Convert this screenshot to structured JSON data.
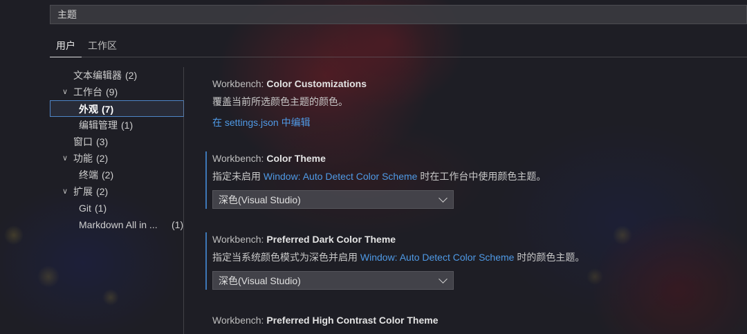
{
  "search": {
    "value": "主题"
  },
  "tabs": [
    {
      "label": "用户",
      "active": true
    },
    {
      "label": "工作区",
      "active": false
    }
  ],
  "toc": [
    {
      "label": "文本编辑器",
      "count": "(2)",
      "indent": 1,
      "chevron": false
    },
    {
      "label": "工作台",
      "count": "(9)",
      "indent": 1,
      "chevron": true
    },
    {
      "label": "外观",
      "count": "(7)",
      "indent": 2,
      "chevron": false,
      "selected": true
    },
    {
      "label": "编辑管理",
      "count": "(1)",
      "indent": 2,
      "chevron": false
    },
    {
      "label": "窗口",
      "count": "(3)",
      "indent": 1,
      "chevron": false
    },
    {
      "label": "功能",
      "count": "(2)",
      "indent": 1,
      "chevron": true
    },
    {
      "label": "终端",
      "count": "(2)",
      "indent": 2,
      "chevron": false
    },
    {
      "label": "扩展",
      "count": "(2)",
      "indent": 1,
      "chevron": true
    },
    {
      "label": "Git",
      "count": "(1)",
      "indent": 2,
      "chevron": false
    },
    {
      "label": "Markdown All in ...",
      "count": "(1)",
      "indent": 2,
      "chevron": false
    }
  ],
  "settings": {
    "color_customizations": {
      "category": "Workbench: ",
      "name": "Color Customizations",
      "description": "覆盖当前所选颜色主题的颜色。",
      "edit_link": "在 settings.json 中编辑"
    },
    "color_theme": {
      "category": "Workbench: ",
      "name": "Color Theme",
      "desc_before": "指定未启用 ",
      "desc_link": "Window: Auto Detect Color Scheme",
      "desc_after": " 时在工作台中使用颜色主题。",
      "value": "深色(Visual Studio)"
    },
    "preferred_dark": {
      "category": "Workbench: ",
      "name": "Preferred Dark Color Theme",
      "desc_before": "指定当系统颜色模式为深色并启用 ",
      "desc_link": "Window: Auto Detect Color Scheme",
      "desc_after": " 时的颜色主题。",
      "value": "深色(Visual Studio)"
    },
    "preferred_high_contrast": {
      "category": "Workbench: ",
      "name": "Preferred High Contrast Color Theme"
    }
  },
  "colors": {
    "link": "#4f9ae6",
    "modified_bar": "#3d78b8",
    "selection_border": "#4f86c8"
  }
}
